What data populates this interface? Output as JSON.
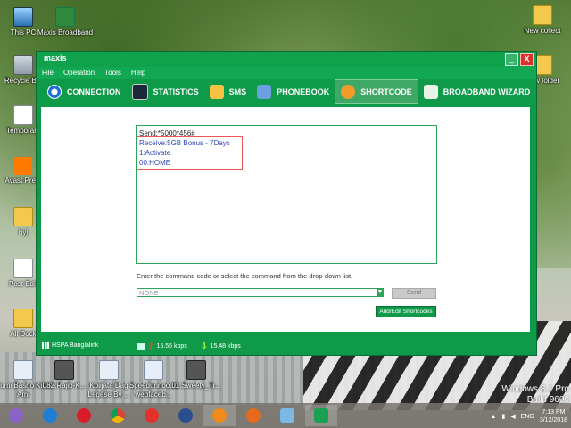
{
  "desktop": {
    "icons": [
      {
        "label": "This PC",
        "icon": "computer-icon"
      },
      {
        "label": "Maxis Broadband",
        "icon": "maxis-app-icon"
      },
      {
        "label": "Recycle Bin",
        "icon": "recycle-bin-icon"
      },
      {
        "label": "Temporary",
        "icon": "word-doc-icon"
      },
      {
        "label": "Avast Prem",
        "icon": "avast-icon"
      },
      {
        "label": "hyj",
        "icon": "folder-icon"
      },
      {
        "label": "Post Edit",
        "icon": "word-doc-icon"
      },
      {
        "label": "All Dock",
        "icon": "folder-icon"
      },
      {
        "label": "New collect",
        "icon": "folder-icon"
      },
      {
        "label": "New folder",
        "icon": "folder-icon"
      },
      {
        "label": "Tumi Basho Kina Ami",
        "icon": "media-file-icon"
      },
      {
        "label": "082.Rajib-K...",
        "icon": "video-thumb-icon"
      },
      {
        "label": "Kolijate Dag Legese By ...",
        "icon": "media-file-icon"
      },
      {
        "label": "Speedunnoodu webfaceb...",
        "icon": "media-file-icon"
      },
      {
        "label": "01.Sweety_Tr...",
        "icon": "video-thumb-icon"
      }
    ],
    "watermark_line1": "Windows 8.1 Pro",
    "watermark_line2": "Build 9600"
  },
  "window": {
    "logo": "maxis",
    "minimize": "_",
    "close": "X",
    "menu": [
      "File",
      "Operation",
      "Tools",
      "Help"
    ],
    "toolbar": [
      {
        "label": "CONNECTION",
        "icon": "connection-icon"
      },
      {
        "label": "STATISTICS",
        "icon": "statistics-icon"
      },
      {
        "label": "SMS",
        "icon": "sms-icon"
      },
      {
        "label": "PHONEBOOK",
        "icon": "phonebook-icon"
      },
      {
        "label": "SHORTCODE",
        "icon": "shortcode-icon"
      },
      {
        "label": "BROADBAND WIZARD",
        "icon": "broadband-wizard-icon"
      }
    ],
    "active_tab": "SHORTCODE",
    "response": {
      "send": "Send:*5000*456#",
      "receive": "Receive:5GB Bonus - 7Days",
      "option1": "1:Activate",
      "option2": "00:HOME"
    },
    "hint": "Enter the command code or select the command from the drop-down list.",
    "command_select": "NONE",
    "send_button": "Send",
    "add_edit_button": "Add/Edit Shortcodes",
    "status": {
      "network": "HSPA Banglalink",
      "upload": "15.55 kbps",
      "download": "15.48 kbps"
    }
  },
  "taskbar": {
    "language": "ENG",
    "time": "7:13 PM",
    "date": "3/12/2018"
  }
}
